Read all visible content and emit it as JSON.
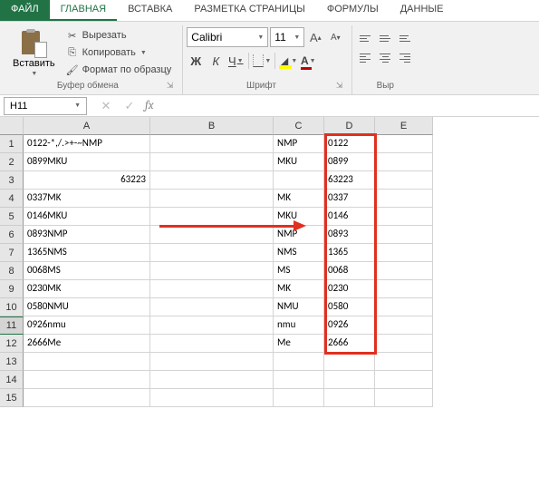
{
  "tabs": {
    "file": "ФАЙЛ",
    "items": [
      "ГЛАВНАЯ",
      "ВСТАВКА",
      "РАЗМЕТКА СТРАНИЦЫ",
      "ФОРМУЛЫ",
      "ДАННЫЕ"
    ],
    "active_index": 0
  },
  "ribbon": {
    "clipboard": {
      "paste": "Вставить",
      "cut": "Вырезать",
      "copy": "Копировать",
      "format_painter": "Формат по образцу",
      "group_label": "Буфер обмена"
    },
    "font": {
      "name": "Calibri",
      "size": "11",
      "grow": "A",
      "shrink": "A",
      "bold": "Ж",
      "italic": "К",
      "underline": "Ч",
      "font_color_letter": "A",
      "group_label": "Шрифт"
    },
    "alignment": {
      "group_label_partial": "Выр"
    }
  },
  "namebox": "H11",
  "formula": "",
  "columns": [
    "A",
    "B",
    "C",
    "D",
    "E"
  ],
  "rows": [
    {
      "n": 1,
      "A": "0122-*,/.>+-~NMP",
      "C": "NMP",
      "D": "0122"
    },
    {
      "n": 2,
      "A": "0899MKU",
      "C": "MKU",
      "D": "0899"
    },
    {
      "n": 3,
      "A_num": "63223",
      "C": "",
      "D": "63223"
    },
    {
      "n": 4,
      "A": "0337MK",
      "C": "MK",
      "D": "0337"
    },
    {
      "n": 5,
      "A": "0146MKU",
      "C": "MKU",
      "D": "0146"
    },
    {
      "n": 6,
      "A": "0893NMP",
      "C": "NMP",
      "D": "0893"
    },
    {
      "n": 7,
      "A": "1365NMS",
      "C": "NMS",
      "D": "1365"
    },
    {
      "n": 8,
      "A": "0068MS",
      "C": "MS",
      "D": "0068"
    },
    {
      "n": 9,
      "A": "0230MK",
      "C": "MK",
      "D": "0230"
    },
    {
      "n": 10,
      "A": "0580NMU",
      "C": "NMU",
      "D": "0580"
    },
    {
      "n": 11,
      "A": "0926nmu",
      "C": "nmu",
      "D": "0926"
    },
    {
      "n": 12,
      "A": "2666Me",
      "C": "Me",
      "D": "2666"
    },
    {
      "n": 13
    },
    {
      "n": 14
    },
    {
      "n": 15
    }
  ],
  "selected_row": 11
}
